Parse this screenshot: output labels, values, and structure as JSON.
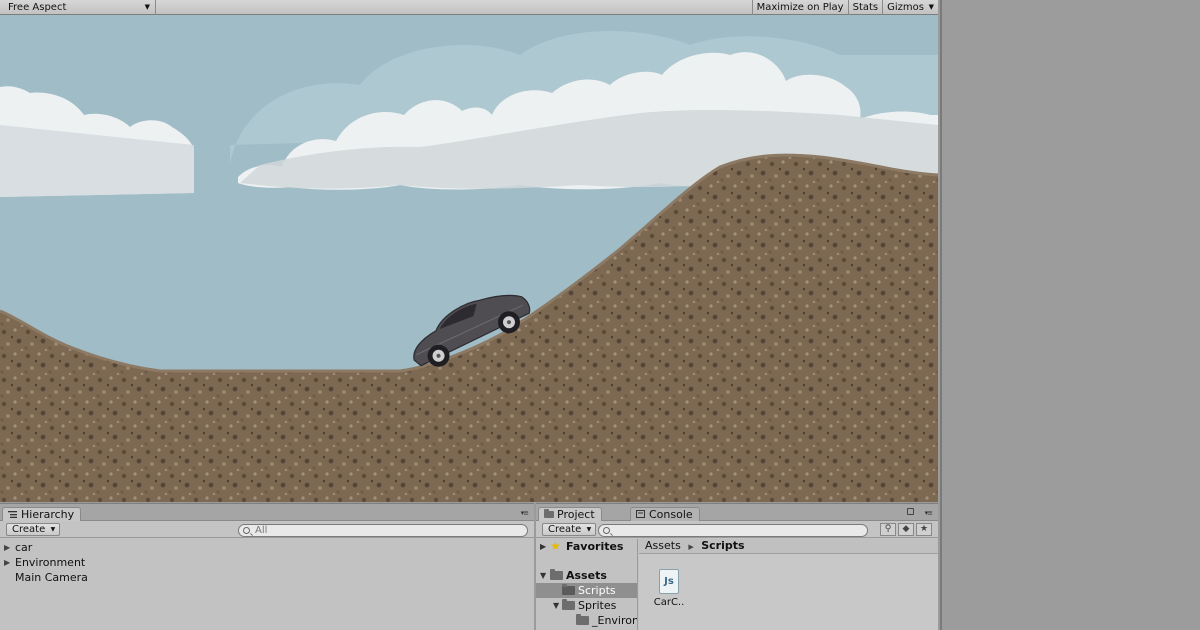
{
  "game_toolbar": {
    "aspect_label": "Free Aspect",
    "maximize_label": "Maximize on Play",
    "stats_label": "Stats",
    "gizmos_label": "Gizmos"
  },
  "hierarchy": {
    "tab_label": "Hierarchy",
    "create_label": "Create",
    "search_placeholder": "All",
    "items": [
      {
        "label": "car",
        "expandable": true
      },
      {
        "label": "Environment",
        "expandable": true
      },
      {
        "label": "Main Camera",
        "expandable": false
      }
    ]
  },
  "project": {
    "tab_label": "Project",
    "console_tab_label": "Console",
    "create_label": "Create",
    "search_placeholder": "",
    "tree": {
      "favorites": "Favorites",
      "assets": "Assets",
      "scripts": "Scripts",
      "sprites": "Sprites",
      "environ": "_Environ"
    },
    "breadcrumb": {
      "root": "Assets",
      "current": "Scripts"
    },
    "asset": {
      "icon_text": "Js",
      "label": "CarC.."
    }
  },
  "colors": {
    "sky": "#9fbcc7",
    "ground": "#7a6550",
    "car": "#4f4c52",
    "panel": "#c2c2c2"
  },
  "icons": {
    "hierarchy_tab": "list-icon",
    "project_tab": "folder-icon",
    "console_tab": "console-icon",
    "favorites": "star-icon",
    "script": "javascript-file-icon"
  }
}
